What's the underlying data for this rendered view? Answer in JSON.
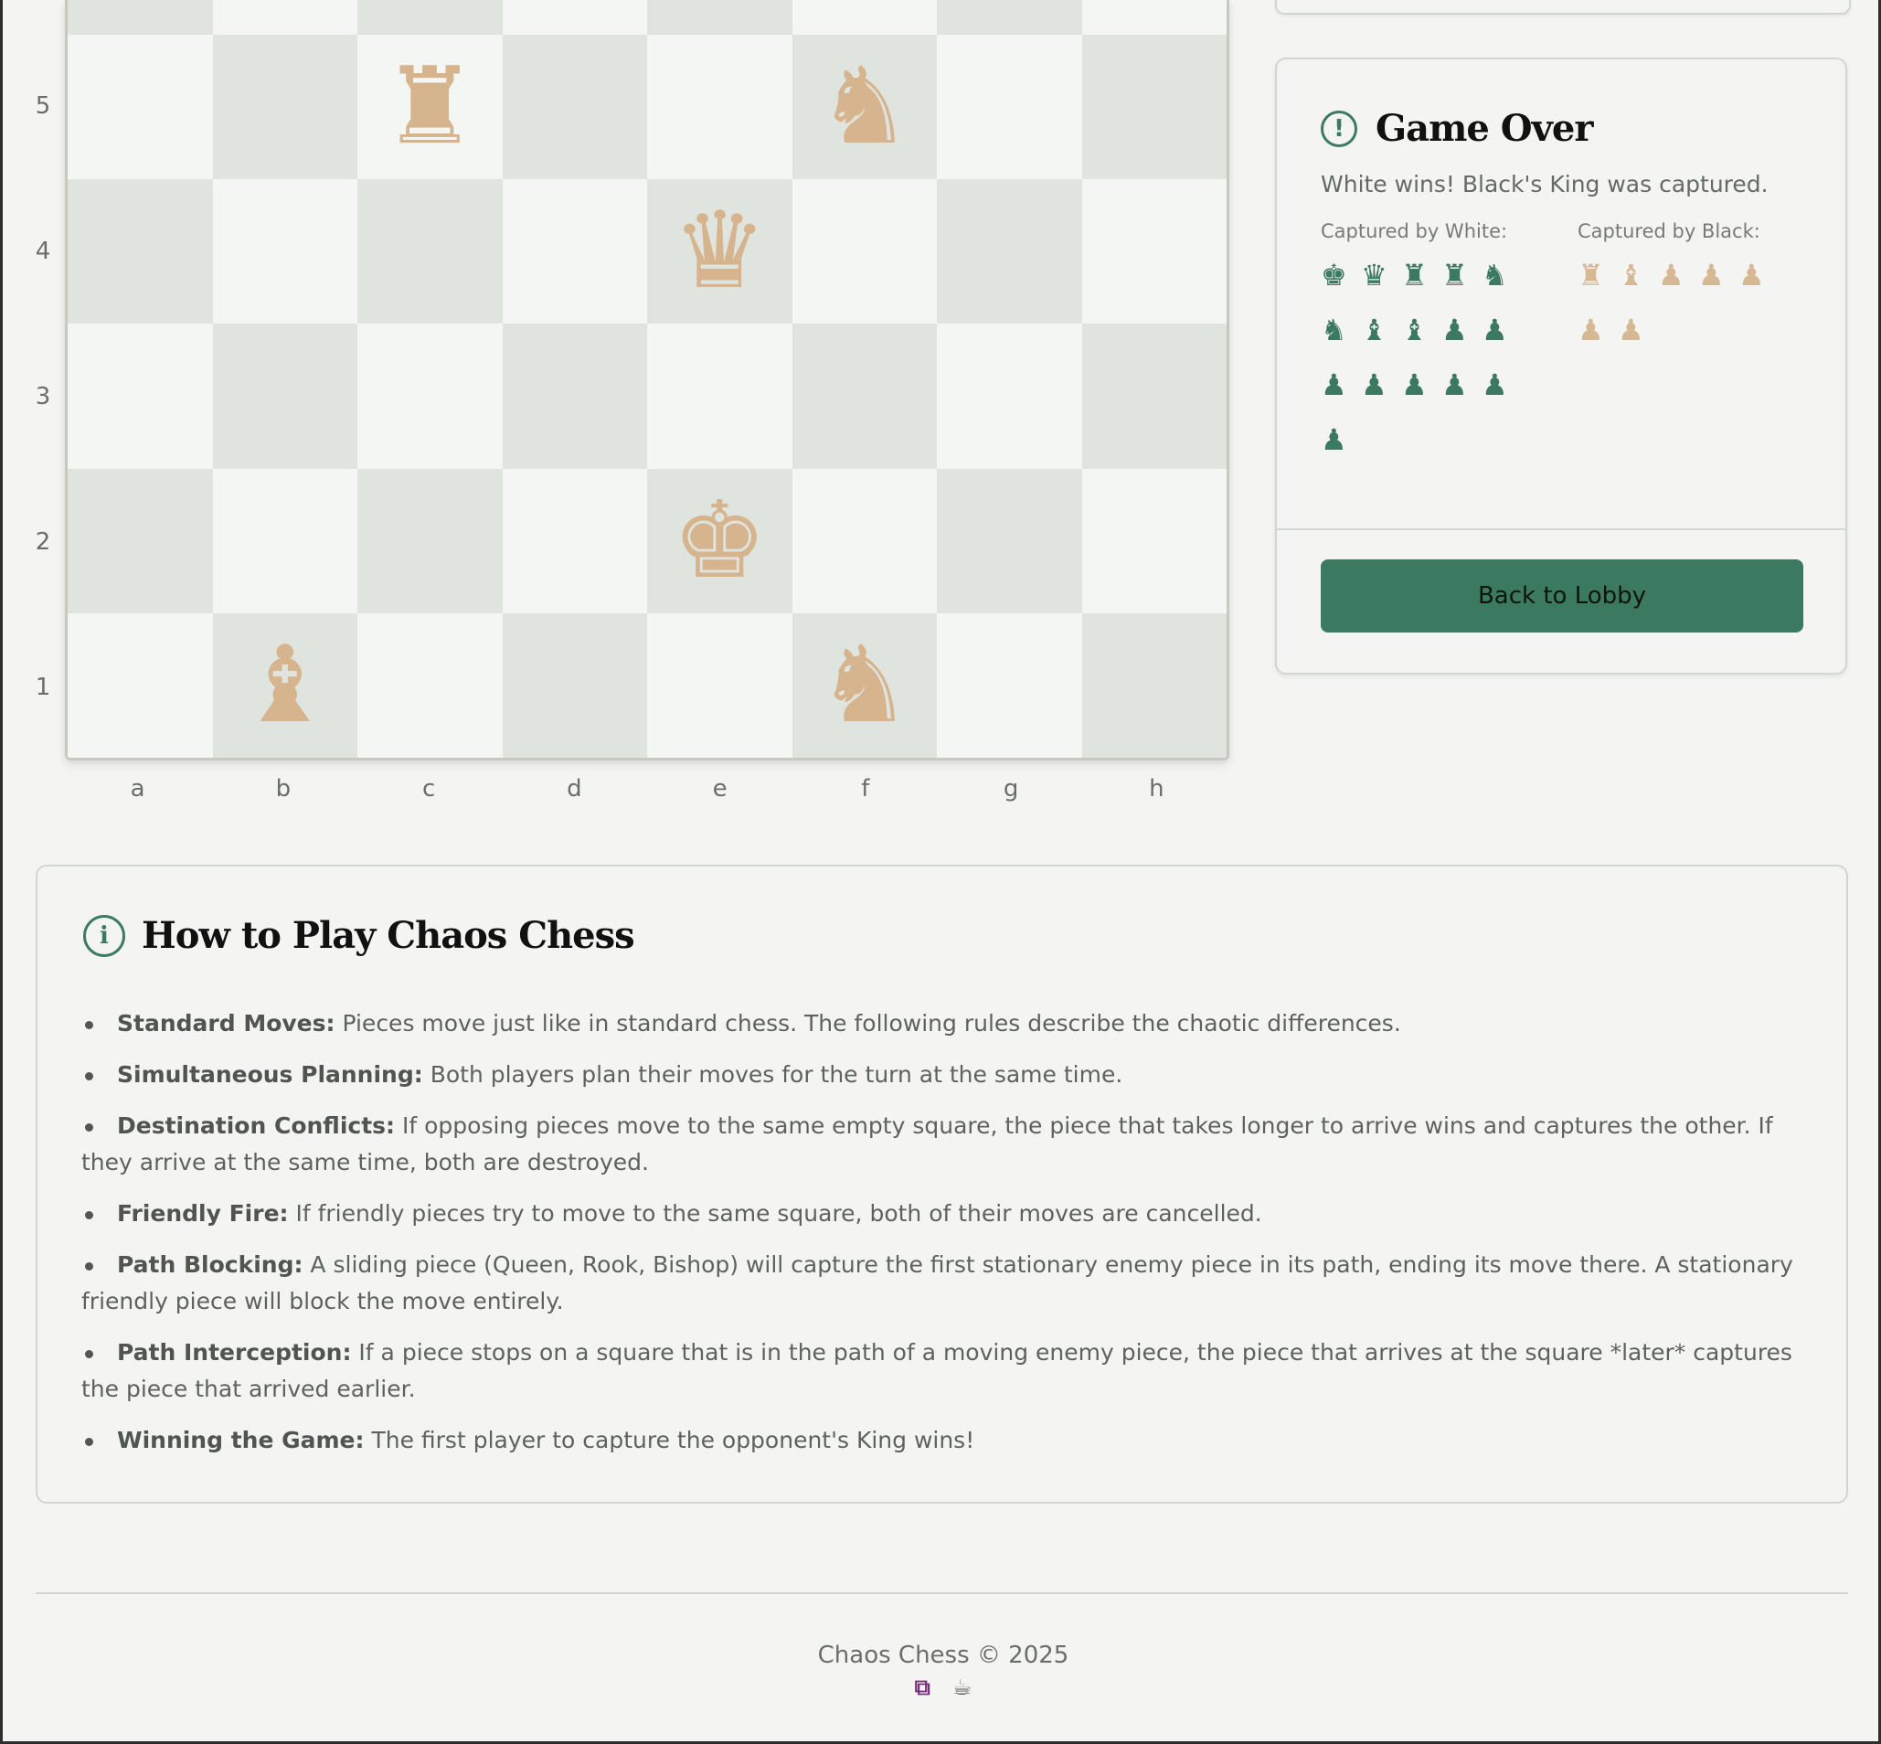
{
  "board": {
    "ranks": [
      "5",
      "4",
      "3",
      "2",
      "1"
    ],
    "files": [
      "a",
      "b",
      "c",
      "d",
      "e",
      "f",
      "g",
      "h"
    ],
    "pieces": [
      {
        "square": "c5",
        "glyph": "♜",
        "name": "rook"
      },
      {
        "square": "f5",
        "glyph": "♞",
        "name": "knight"
      },
      {
        "square": "e4",
        "glyph": "♛",
        "name": "queen"
      },
      {
        "square": "e2",
        "glyph": "♚",
        "name": "king"
      },
      {
        "square": "b1",
        "glyph": "♝",
        "name": "bishop"
      },
      {
        "square": "f1",
        "glyph": "♞",
        "name": "knight"
      }
    ],
    "piece_color": "#d5b48e",
    "light_square": "#f4f6f3",
    "dark_square": "#e0e4df"
  },
  "game_over": {
    "icon": "alert-circle-icon",
    "icon_glyph": "!",
    "title": "Game Over",
    "result": "White wins! Black's King was captured.",
    "captured_by_white_label": "Captured by White:",
    "captured_by_black_label": "Captured by Black:",
    "captured_by_white": [
      "♚",
      "♛",
      "♜",
      "♜",
      "♞",
      "♞",
      "♝",
      "♝",
      "♟",
      "♟",
      "♟",
      "♟",
      "♟",
      "♟",
      "♟",
      "♟"
    ],
    "captured_by_black": [
      "♜",
      "♝",
      "♟",
      "♟",
      "♟",
      "♟",
      "♟"
    ],
    "button_label": "Back to Lobby",
    "accent": "#3b7a60"
  },
  "how_to_play": {
    "icon": "info-circle-icon",
    "icon_glyph": "i",
    "title": "How to Play Chaos Chess",
    "rules": [
      {
        "term": "Standard Moves:",
        "text": " Pieces move just like in standard chess. The following rules describe the chaotic differences."
      },
      {
        "term": "Simultaneous Planning:",
        "text": " Both players plan their moves for the turn at the same time."
      },
      {
        "term": "Destination Conflicts:",
        "text": " If opposing pieces move to the same empty square, the piece that takes longer to arrive wins and captures the other. If they arrive at the same time, both are destroyed."
      },
      {
        "term": "Friendly Fire:",
        "text": " If friendly pieces try to move to the same square, both of their moves are cancelled."
      },
      {
        "term": "Path Blocking:",
        "text": " A sliding piece (Queen, Rook, Bishop) will capture the first stationary enemy piece in its path, ending its move there. A stationary friendly piece will block the move entirely."
      },
      {
        "term": "Path Interception:",
        "text": " If a piece stops on a square that is in the path of a moving enemy piece, the piece that arrives at the square *later* captures the piece that arrived earlier."
      },
      {
        "term": "Winning the Game:",
        "text": " The first player to capture the opponent's King wins!"
      }
    ]
  },
  "footer": {
    "text": "Chaos Chess © 2025",
    "icons": [
      "brand-icon",
      "coffee-cup-icon"
    ]
  }
}
